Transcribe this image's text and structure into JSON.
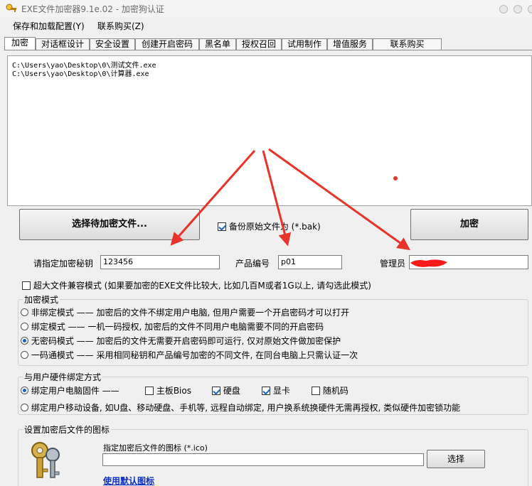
{
  "window": {
    "title": "EXE文件加密器9.1e.02 - 加密狗认证"
  },
  "menu": [
    "保存和加载配置(Y)",
    "联系购买(Z)"
  ],
  "tabs": [
    "加密",
    "对话框设计",
    "安全设置",
    "创建开启密码",
    "黑名单",
    "授权召回",
    "试用制作",
    "增值服务",
    "联系购买"
  ],
  "active_tab": "加密",
  "file_list": [
    "C:\\Users\\yao\\Desktop\\0\\测试文件.exe",
    "C:\\Users\\yao\\Desktop\\0\\计算器.exe"
  ],
  "buttons": {
    "select_files": "选择待加密文件...",
    "encrypt": "加密",
    "choose_icon": "选择"
  },
  "backup_checkbox": {
    "label": "备份原始文件为 (*.bak)",
    "checked": true
  },
  "fields": {
    "key_label": "请指定加密秘钥",
    "key_value": "123456",
    "product_label": "产品编号",
    "product_value": "p01",
    "admin_label": "管理员",
    "admin_value": ""
  },
  "large_file_checkbox": {
    "label": "超大文件兼容模式 (如果要加密的EXE文件比较大, 比如几百M或者1G以上, 请勾选此模式)",
    "checked": false
  },
  "encrypt_mode": {
    "title": "加密模式",
    "options": [
      {
        "label": "非绑定模式 —— 加密后的文件不绑定用户电脑, 但用户需要一个开启密码才可以打开",
        "selected": false
      },
      {
        "label": "绑定模式 —— 一机一码授权, 加密后的文件不同用户电脑需要不同的开启密码",
        "selected": false
      },
      {
        "label": "无密码模式 —— 加密后的文件无需要开启密码即可运行, 仅对原始文件做加密保护",
        "selected": true
      },
      {
        "label": "一码通模式 —— 采用相同秘钥和产品编号加密的不同文件, 在同台电脑上只需认证一次",
        "selected": false
      }
    ]
  },
  "hardware_binding": {
    "title": "与用户硬件绑定方式",
    "opt1": {
      "label": "绑定用户电脑固件 ——",
      "selected": true
    },
    "checks": [
      {
        "label": "主板Bios",
        "checked": false
      },
      {
        "label": "硬盘",
        "checked": true
      },
      {
        "label": "显卡",
        "checked": true
      },
      {
        "label": "随机码",
        "checked": false
      }
    ],
    "opt2": {
      "label": "绑定用户移动设备, 如U盘、移动硬盘、手机等, 远程自动绑定, 用户换系统换硬件无需再授权, 类似硬件加密锁功能",
      "selected": false
    }
  },
  "icon_section": {
    "title": "设置加密后文件的图标",
    "prompt": "指定加密后文件的图标 (*.ico)",
    "path_value": "",
    "default_link": "使用默认图标"
  },
  "colors": {
    "arrow": "#e8322a",
    "link": "#0b2fc8",
    "redaction": "#ff1a1a"
  }
}
